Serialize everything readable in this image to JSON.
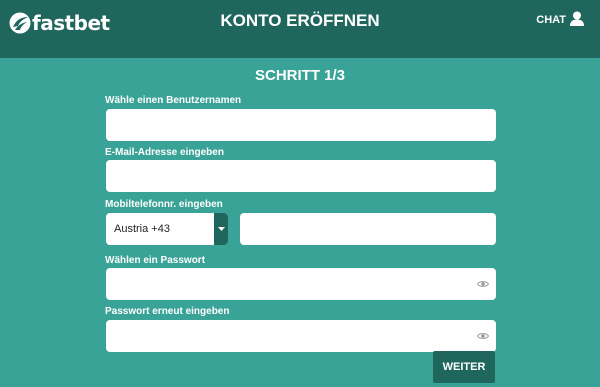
{
  "header": {
    "logo_text": "fastbet",
    "title": "KONTO ERÖFFNEN",
    "chat_label": "CHAT"
  },
  "form": {
    "step_title": "SCHRITT 1/3",
    "username": {
      "label": "Wähle einen Benutzernamen",
      "value": ""
    },
    "email": {
      "label": "E-Mail-Adresse eingeben",
      "value": ""
    },
    "phone": {
      "label": "Mobiltelefonnr. eingeben",
      "country_selected": "Austria +43",
      "value": ""
    },
    "password": {
      "label": "Wählen ein Passwort",
      "value": ""
    },
    "password_confirm": {
      "label": "Passwort erneut eingeben",
      "value": ""
    },
    "submit_label": "WEITER"
  },
  "icons": {
    "logo": "fastbet-logo-icon",
    "chat": "user-icon",
    "dropdown": "caret-down-icon",
    "password_toggle": "eye-icon"
  },
  "colors": {
    "background": "#3aa397",
    "header": "#1f665d",
    "button": "#1f665d",
    "field": "#ffffff"
  }
}
